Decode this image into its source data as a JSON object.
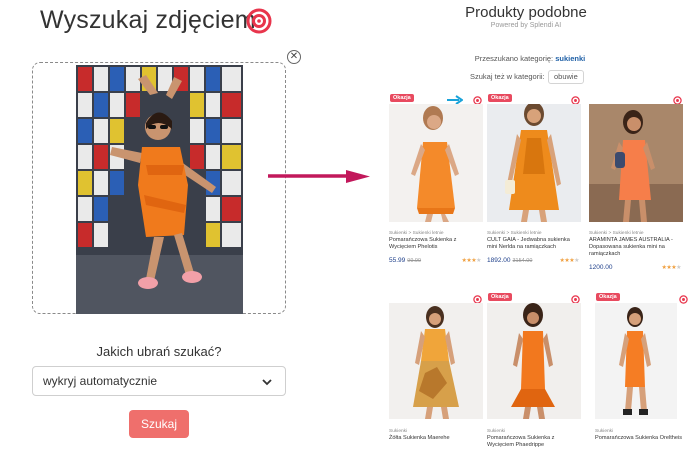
{
  "left": {
    "title": "Wyszukaj zdjęciem",
    "close_symbol": "✕",
    "question": "Jakich ubrań szukać?",
    "select_value": "wykryj automatycznie",
    "search_button": "Szukaj"
  },
  "right": {
    "title": "Produkty podobne",
    "powered": "Powered by Splendi AI",
    "searched_prefix": "Przeszukano kategorię:",
    "searched_category": "sukienki",
    "also_label": "Szukaj też w kategorii:",
    "also_chip": "obuwie"
  },
  "colors": {
    "accent": "#e8354c",
    "search_button": "#ef6f6c",
    "arrow": "#c2185b",
    "price": "#1e3f8a",
    "stars": "#f0a040"
  },
  "products": [
    {
      "badge": "Okazja",
      "breadcrumb": "Sukienki > Sukienki letnie",
      "name": "Pomarańczowa Sukienka z Wycięciem Phelotis",
      "price": "55.99",
      "old_price": "99.99",
      "rating": 4
    },
    {
      "badge": "Okazja",
      "breadcrumb": "Sukienki > Sukienki letnie",
      "name": "CULT GAIA - Jedwabna sukienka mini Nerlda na ramiączkach",
      "price": "1892.00",
      "old_price": "3154.00",
      "rating": 4
    },
    {
      "badge": "",
      "breadcrumb": "Sukienki > Sukienki letnie",
      "name": "ARAMINTA JAMES AUSTRALIA - Dopasowana sukienka mini na ramiączkach",
      "price": "1200.00",
      "old_price": "",
      "rating": 4
    },
    {
      "badge": "",
      "breadcrumb": "Sukienki",
      "name": "Żółta Sukienka Maerehe",
      "price": "",
      "old_price": "",
      "rating": 0
    },
    {
      "badge": "Okazja",
      "breadcrumb": "Sukienki",
      "name": "Pomarańczowa Sukienka z Wycięciem Phaedrippe",
      "price": "",
      "old_price": "",
      "rating": 0
    },
    {
      "badge": "Okazja",
      "breadcrumb": "Sukienki",
      "name": "Pomarańczowa Sukienka Oreltheis",
      "price": "",
      "old_price": "",
      "rating": 0
    }
  ]
}
